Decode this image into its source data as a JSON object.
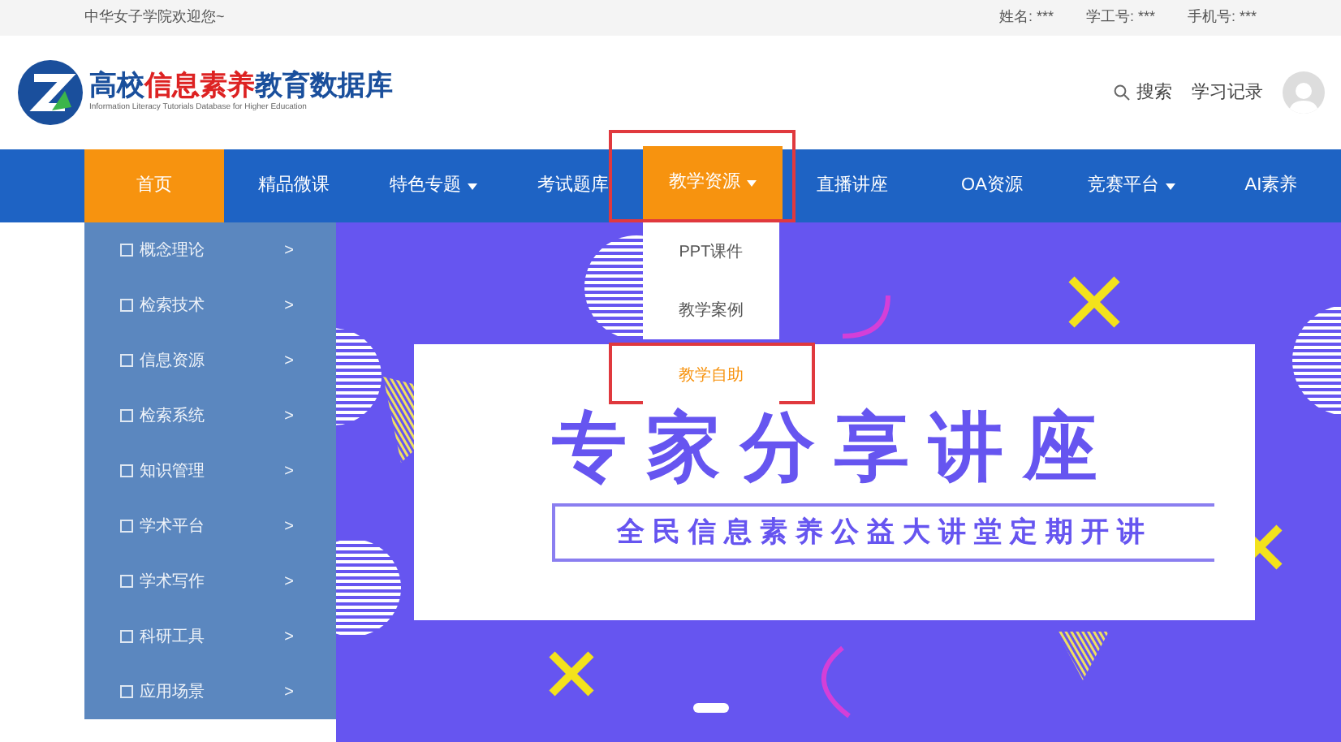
{
  "top_bar": {
    "welcome": "中华女子学院欢迎您~",
    "user_fields": [
      {
        "label": "姓名: ***"
      },
      {
        "label": "学工号: ***"
      },
      {
        "label": "手机号: ***"
      }
    ]
  },
  "header": {
    "logo_parts": [
      {
        "text": "高校",
        "accent": false
      },
      {
        "text": "信息素养",
        "accent": true
      },
      {
        "text": "教育数据库",
        "accent": false
      }
    ],
    "logo_subtitle": "Information Literacy Tutorials Database for Higher Education",
    "search": "搜索",
    "records": "学习记录"
  },
  "nav": [
    {
      "label": "首页",
      "selected": true,
      "dropdown": false,
      "highlighted": false
    },
    {
      "label": "精品微课",
      "selected": false,
      "dropdown": false,
      "highlighted": false
    },
    {
      "label": "特色专题",
      "selected": false,
      "dropdown": true,
      "highlighted": false
    },
    {
      "label": "考试题库",
      "selected": false,
      "dropdown": false,
      "highlighted": false
    },
    {
      "label": "教学资源",
      "selected": true,
      "dropdown": true,
      "highlighted": true
    },
    {
      "label": "直播讲座",
      "selected": false,
      "dropdown": false,
      "highlighted": false
    },
    {
      "label": "OA资源",
      "selected": false,
      "dropdown": false,
      "highlighted": false
    },
    {
      "label": "竞赛平台",
      "selected": false,
      "dropdown": true,
      "highlighted": false
    },
    {
      "label": "AI素养",
      "selected": false,
      "dropdown": false,
      "highlighted": false
    }
  ],
  "dropdown": [
    {
      "label": "PPT课件",
      "selected": false,
      "highlighted": false
    },
    {
      "label": "教学案例",
      "selected": false,
      "highlighted": false
    },
    {
      "label": "教学自助",
      "selected": true,
      "highlighted": true
    }
  ],
  "sidebar": {
    "items": [
      {
        "label": "概念理论",
        "chevron": ">"
      },
      {
        "label": "检索技术",
        "chevron": ">"
      },
      {
        "label": "信息资源",
        "chevron": ">"
      },
      {
        "label": "检索系统",
        "chevron": ">"
      },
      {
        "label": "知识管理",
        "chevron": ">"
      },
      {
        "label": "学术平台",
        "chevron": ">"
      },
      {
        "label": "学术写作",
        "chevron": ">"
      },
      {
        "label": "科研工具",
        "chevron": ">"
      },
      {
        "label": "应用场景",
        "chevron": ">"
      }
    ]
  },
  "banner": {
    "title": "专家分享讲座",
    "subtitle": "全民信息素养公益大讲堂定期开讲"
  }
}
